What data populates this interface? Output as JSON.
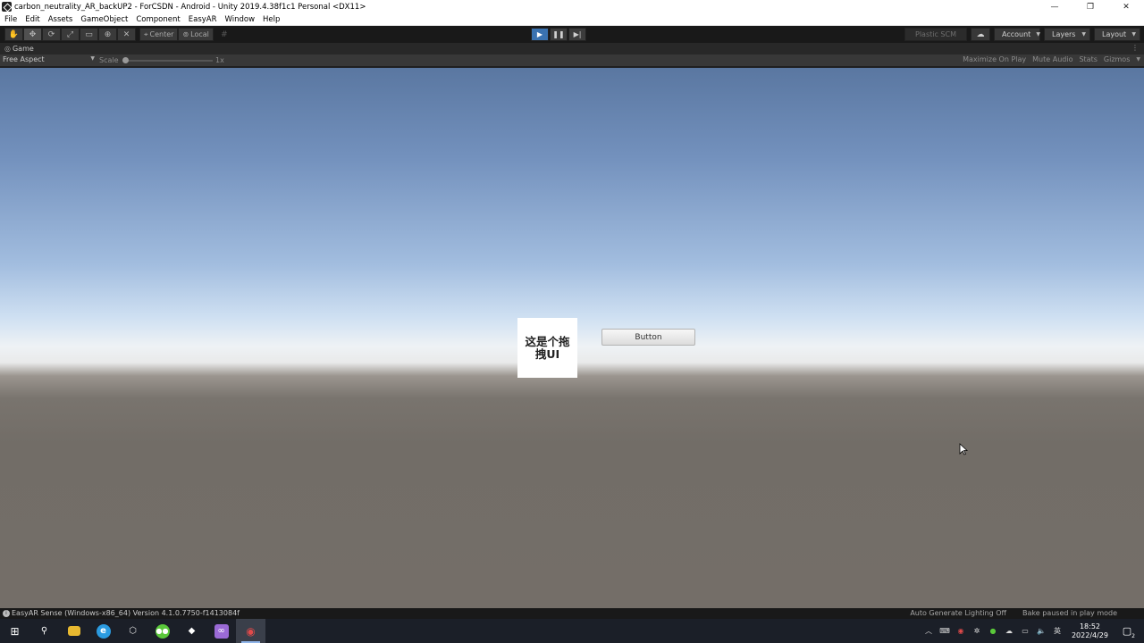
{
  "window": {
    "title": "carbon_neutrality_AR_backUP2 - ForCSDN - Android - Unity 2019.4.38f1c1 Personal <DX11>",
    "minimize_glyph": "—",
    "restore_glyph": "❐",
    "close_glyph": "✕"
  },
  "menu": {
    "items": [
      "File",
      "Edit",
      "Assets",
      "GameObject",
      "Component",
      "EasyAR",
      "Window",
      "Help"
    ]
  },
  "toolbar": {
    "tools": [
      "hand-tool",
      "move-tool",
      "rotate-tool",
      "scale-tool",
      "rect-tool",
      "transform-tool",
      "custom-tool"
    ],
    "active_tool": "move-tool",
    "pivot_label": "Center",
    "space_label": "Local",
    "plastic_label": "Plastic SCM",
    "account_label": "Account",
    "layers_label": "Layers",
    "layout_label": "Layout"
  },
  "game_view": {
    "tab_label": "Game",
    "aspect_label": "Free Aspect",
    "scale_label": "Scale",
    "scale_value": "1x",
    "maximize_label": "Maximize On Play",
    "mute_label": "Mute Audio",
    "stats_label": "Stats",
    "gizmos_label": "Gizmos",
    "drag_ui_text": "这是个拖拽UI",
    "button_label": "Button"
  },
  "status": {
    "message": "EasyAR Sense (Windows-x86_64) Version 4.1.0.7750-f1413084f",
    "lighting": "Auto Generate Lighting Off",
    "bake": "Bake paused in play mode"
  },
  "taskbar": {
    "apps": [
      {
        "name": "windows-start-icon",
        "glyph": "⊞",
        "color": "#ffffff"
      },
      {
        "name": "search-icon",
        "glyph": "⚲",
        "color": "#ffffff"
      },
      {
        "name": "file-explorer-icon",
        "glyph": "▬",
        "color": "#e8b930"
      },
      {
        "name": "edge-browser-icon",
        "glyph": "e",
        "color": "#2b9be0"
      },
      {
        "name": "unity-hub-icon",
        "glyph": "⬡",
        "color": "#e0e0e0"
      },
      {
        "name": "wechat-icon",
        "glyph": "●",
        "color": "#5ac83a"
      },
      {
        "name": "unity-editor-icon",
        "glyph": "◆",
        "color": "#ffffff"
      },
      {
        "name": "visual-studio-icon",
        "glyph": "∞",
        "color": "#9a6ad6"
      },
      {
        "name": "screen-recorder-icon",
        "glyph": "◉",
        "color": "#e04a4a"
      }
    ],
    "ime_label": "英",
    "time": "18:52",
    "date": "2022/4/29",
    "notification_count": "2"
  }
}
